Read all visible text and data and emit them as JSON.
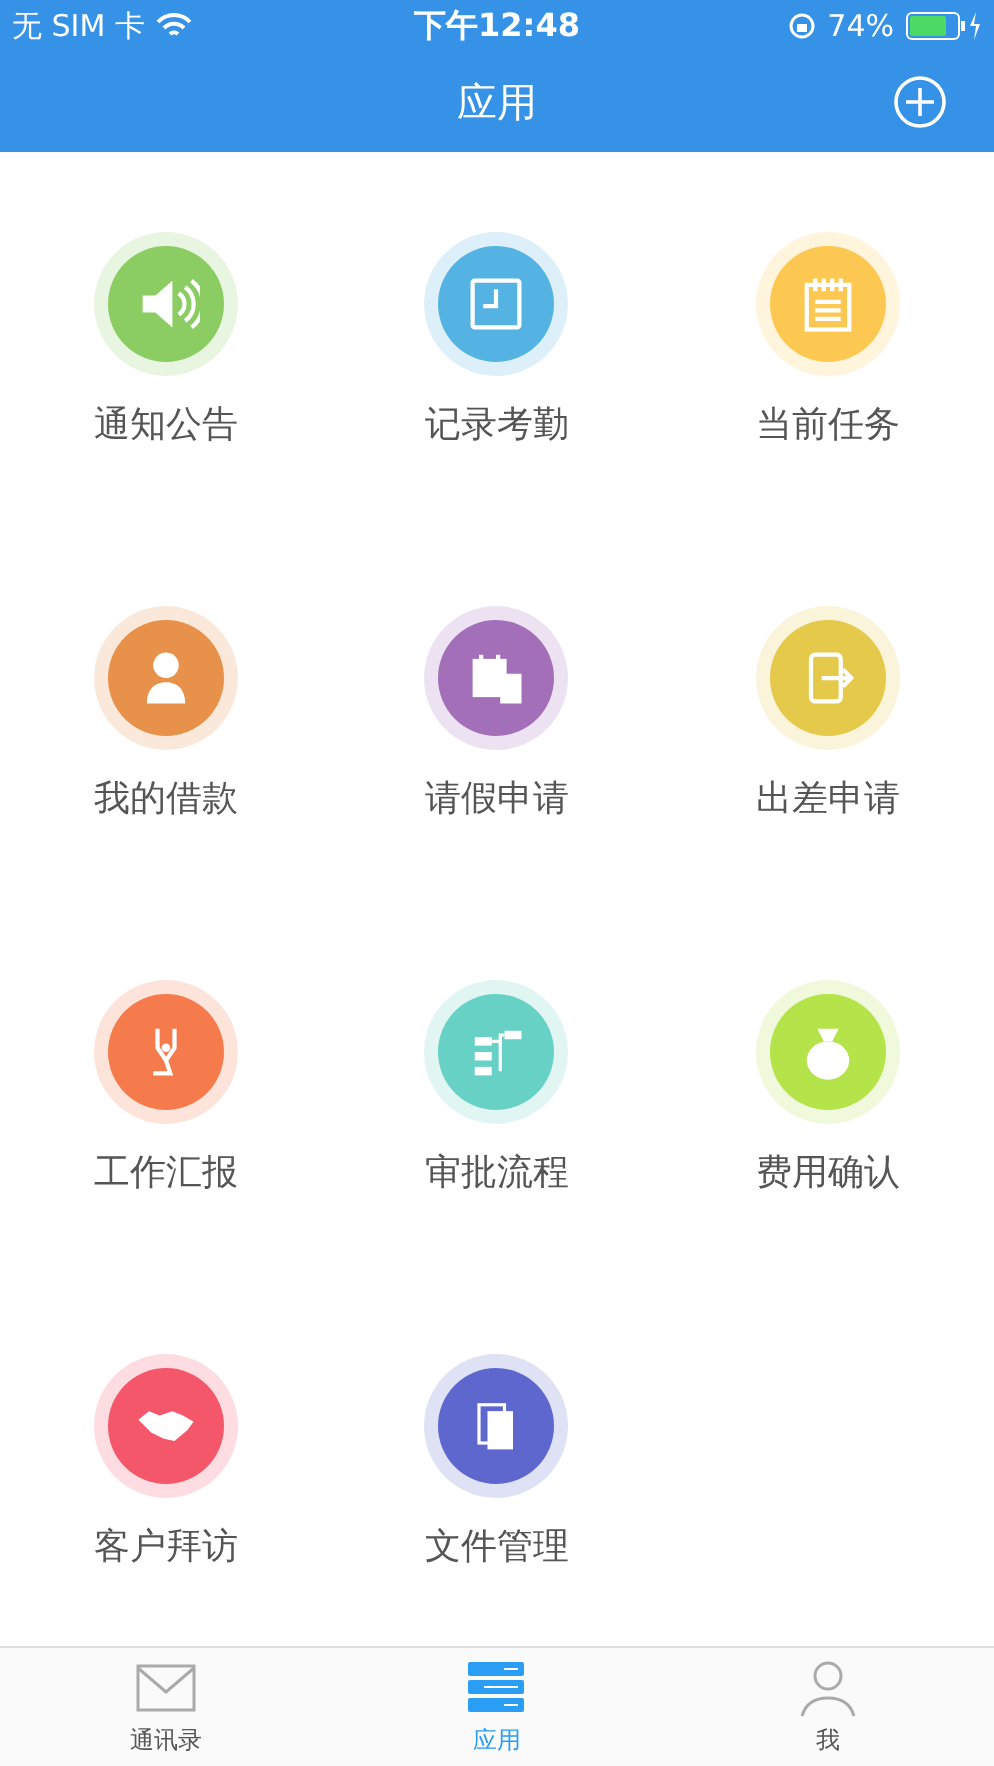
{
  "status_bar": {
    "carrier": "无 SIM 卡",
    "time": "下午12:48",
    "battery": "74%"
  },
  "nav": {
    "title": "应用"
  },
  "apps": [
    {
      "label": "通知公告",
      "kind": "speaker",
      "color": "#8ccd63"
    },
    {
      "label": "记录考勤",
      "kind": "clock",
      "color": "#54b3e3"
    },
    {
      "label": "当前任务",
      "kind": "notepad",
      "color": "#fdc851"
    },
    {
      "label": "我的借款",
      "kind": "loan",
      "color": "#e8914a"
    },
    {
      "label": "请假申请",
      "kind": "calendar",
      "color": "#a26fb8"
    },
    {
      "label": "出差申请",
      "kind": "tablet",
      "color": "#e5c94a"
    },
    {
      "label": "工作汇报",
      "kind": "pen",
      "color": "#f57a4c"
    },
    {
      "label": "审批流程",
      "kind": "flow",
      "color": "#67d1c5"
    },
    {
      "label": "费用确认",
      "kind": "moneybag",
      "color": "#b4e34a"
    },
    {
      "label": "客户拜访",
      "kind": "handshake",
      "color": "#f4576a"
    },
    {
      "label": "文件管理",
      "kind": "documents",
      "color": "#5e67cd"
    }
  ],
  "tabs": [
    {
      "label": "通讯录",
      "kind": "mail",
      "selected": false
    },
    {
      "label": "应用",
      "kind": "apps",
      "selected": true
    },
    {
      "label": "我",
      "kind": "person",
      "selected": false
    }
  ]
}
